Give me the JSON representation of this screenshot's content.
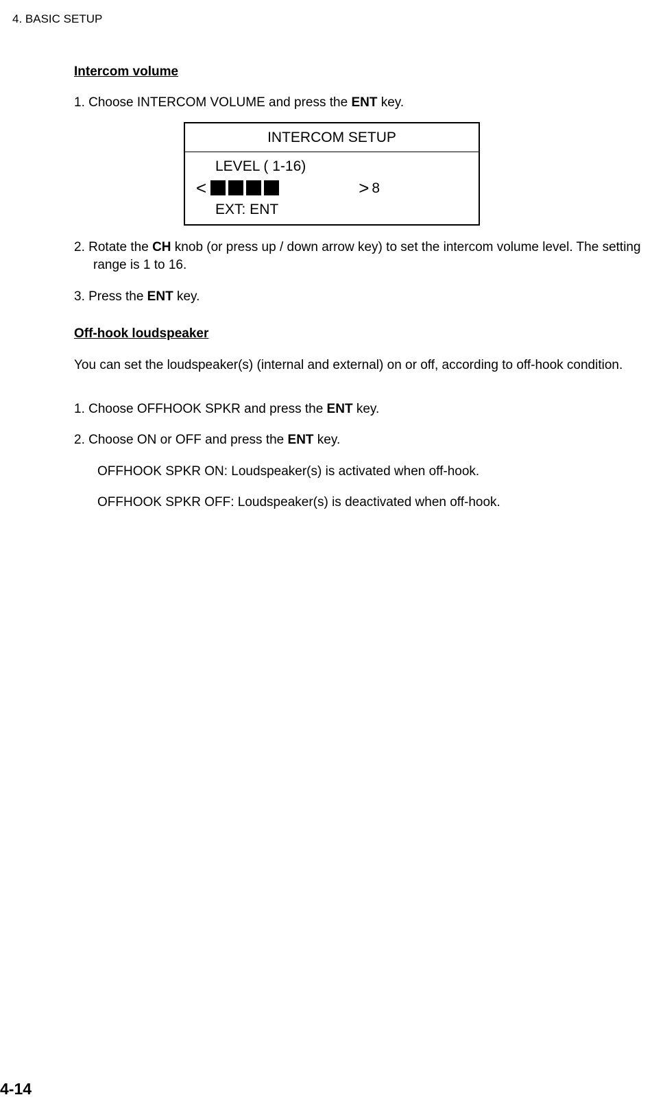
{
  "header": {
    "chapter": "4. BASIC SETUP"
  },
  "section1": {
    "title": "Intercom volume",
    "step1_pre": "1. Choose INTERCOM VOLUME and press the ",
    "step1_bold": "ENT",
    "step1_post": " key.",
    "step2_pre": "2. Rotate the ",
    "step2_bold": "CH",
    "step2_post": " knob (or press up / down arrow key) to set the intercom volume level. The setting range is 1 to 16.",
    "step3_pre": "3. Press the ",
    "step3_bold": "ENT",
    "step3_post": " key."
  },
  "screen": {
    "title": "INTERCOM SETUP",
    "level_label": "LEVEL  ( 1-16)",
    "lt": "<",
    "gt": ">",
    "value": "8",
    "exit": "EXT: ENT"
  },
  "section2": {
    "title": "Off-hook loudspeaker",
    "desc": "You can set the loudspeaker(s) (internal and external) on or off, according to off-hook condition.",
    "step1_pre": "1. Choose OFFHOOK SPKR and press the ",
    "step1_bold": "ENT",
    "step1_post": " key.",
    "step2_pre": "2. Choose ON or OFF and press the ",
    "step2_bold": "ENT",
    "step2_post": " key.",
    "sub1": "OFFHOOK SPKR ON: Loudspeaker(s) is activated when off-hook.",
    "sub2": "OFFHOOK SPKR OFF: Loudspeaker(s) is deactivated when off-hook."
  },
  "page_number": "4-14"
}
